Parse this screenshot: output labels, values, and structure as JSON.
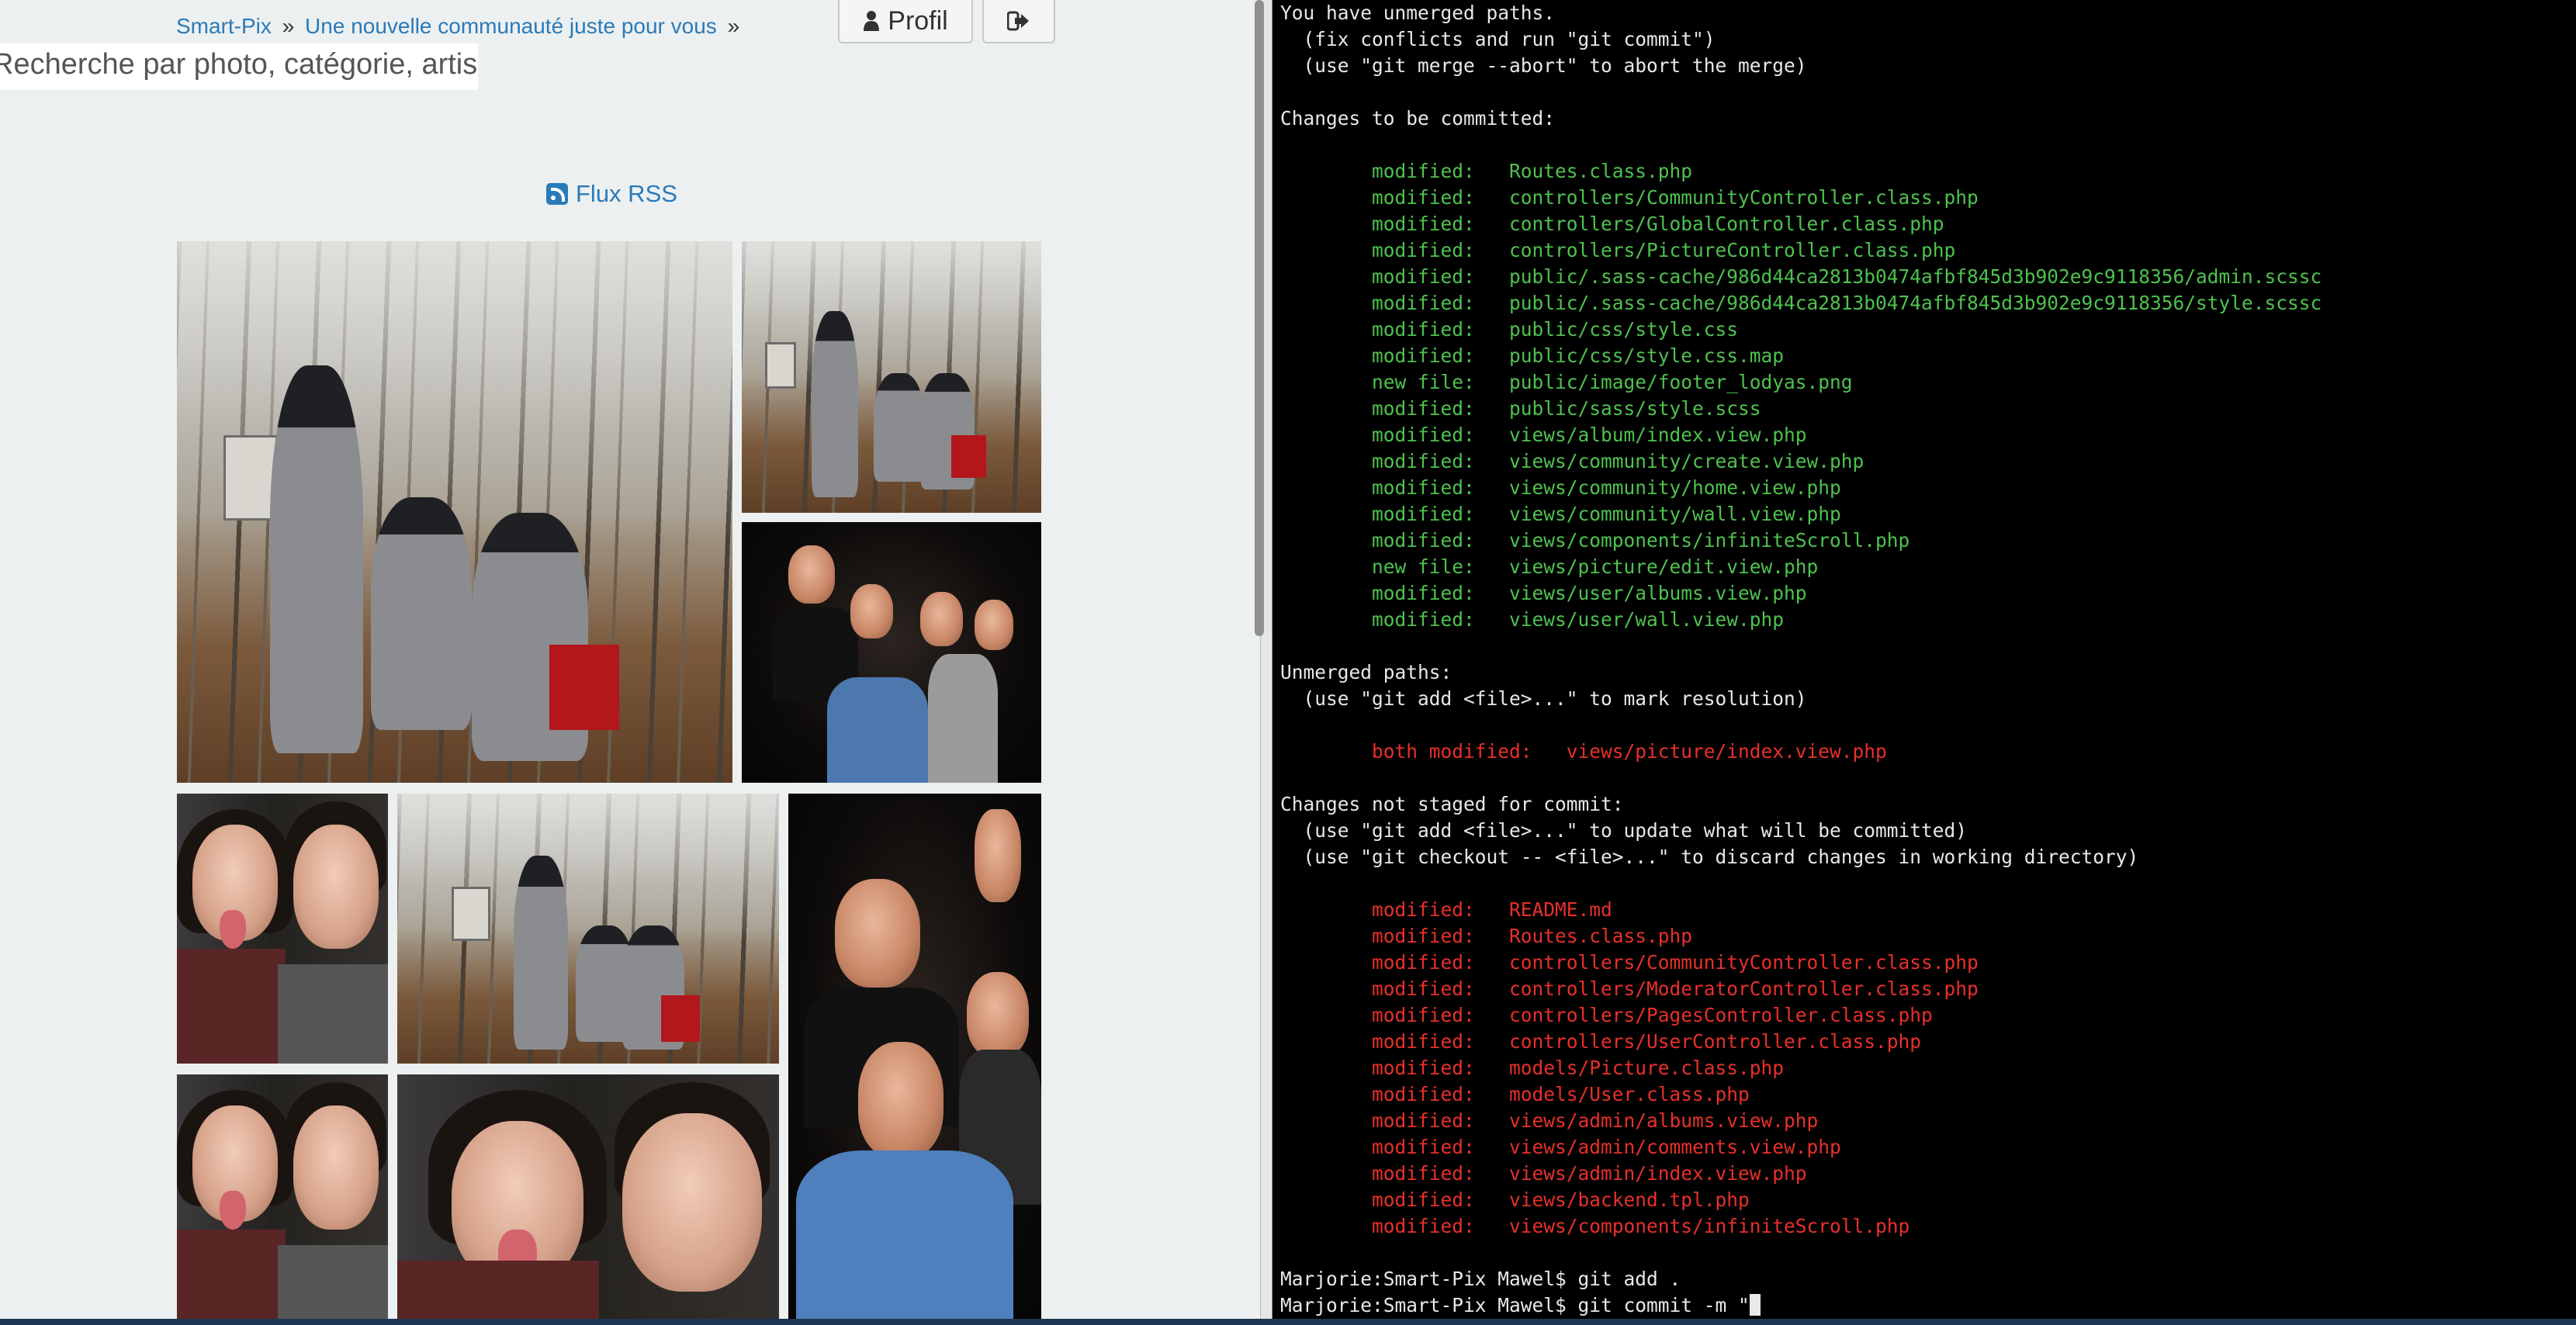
{
  "browser": {
    "breadcrumb": [
      {
        "label": "Smart-Pix",
        "sep": "»"
      },
      {
        "label": "Une nouvelle communauté juste pour vous",
        "sep": "»"
      }
    ],
    "buttons": {
      "profil_label": "Profil",
      "profil_icon": "user-icon",
      "logout_icon": "sign-out-icon"
    },
    "search": {
      "placeholder": "Recherche par photo, catégorie, artis"
    },
    "rss": {
      "label": "Flux RSS",
      "icon": "rss-icon"
    },
    "colors": {
      "link": "#2a7ab8",
      "background": "#ecf0f1"
    }
  },
  "terminal": {
    "lines": [
      {
        "text": "You have unmerged paths.",
        "style": "normal"
      },
      {
        "text": "  (fix conflicts and run \"git commit\")",
        "style": "normal"
      },
      {
        "text": "  (use \"git merge --abort\" to abort the merge)",
        "style": "normal"
      },
      {
        "text": "",
        "style": "normal"
      },
      {
        "text": "Changes to be committed:",
        "style": "normal"
      },
      {
        "text": "",
        "style": "normal"
      },
      {
        "text": "\tmodified:   Routes.class.php",
        "style": "green"
      },
      {
        "text": "\tmodified:   controllers/CommunityController.class.php",
        "style": "green"
      },
      {
        "text": "\tmodified:   controllers/GlobalController.class.php",
        "style": "green"
      },
      {
        "text": "\tmodified:   controllers/PictureController.class.php",
        "style": "green"
      },
      {
        "text": "\tmodified:   public/.sass-cache/986d44ca2813b0474afbf845d3b902e9c9118356/admin.scssc",
        "style": "green"
      },
      {
        "text": "\tmodified:   public/.sass-cache/986d44ca2813b0474afbf845d3b902e9c9118356/style.scssc",
        "style": "green"
      },
      {
        "text": "\tmodified:   public/css/style.css",
        "style": "green"
      },
      {
        "text": "\tmodified:   public/css/style.css.map",
        "style": "green"
      },
      {
        "text": "\tnew file:   public/image/footer_lodyas.png",
        "style": "green"
      },
      {
        "text": "\tmodified:   public/sass/style.scss",
        "style": "green"
      },
      {
        "text": "\tmodified:   views/album/index.view.php",
        "style": "green"
      },
      {
        "text": "\tmodified:   views/community/create.view.php",
        "style": "green"
      },
      {
        "text": "\tmodified:   views/community/home.view.php",
        "style": "green"
      },
      {
        "text": "\tmodified:   views/community/wall.view.php",
        "style": "green"
      },
      {
        "text": "\tmodified:   views/components/infiniteScroll.php",
        "style": "green"
      },
      {
        "text": "\tnew file:   views/picture/edit.view.php",
        "style": "green"
      },
      {
        "text": "\tmodified:   views/user/albums.view.php",
        "style": "green"
      },
      {
        "text": "\tmodified:   views/user/wall.view.php",
        "style": "green"
      },
      {
        "text": "",
        "style": "normal"
      },
      {
        "text": "Unmerged paths:",
        "style": "normal"
      },
      {
        "text": "  (use \"git add <file>...\" to mark resolution)",
        "style": "normal"
      },
      {
        "text": "",
        "style": "normal"
      },
      {
        "text": "\tboth modified:   views/picture/index.view.php",
        "style": "red"
      },
      {
        "text": "",
        "style": "normal"
      },
      {
        "text": "Changes not staged for commit:",
        "style": "normal"
      },
      {
        "text": "  (use \"git add <file>...\" to update what will be committed)",
        "style": "normal"
      },
      {
        "text": "  (use \"git checkout -- <file>...\" to discard changes in working directory)",
        "style": "normal"
      },
      {
        "text": "",
        "style": "normal"
      },
      {
        "text": "\tmodified:   README.md",
        "style": "red"
      },
      {
        "text": "\tmodified:   Routes.class.php",
        "style": "red"
      },
      {
        "text": "\tmodified:   controllers/CommunityController.class.php",
        "style": "red"
      },
      {
        "text": "\tmodified:   controllers/ModeratorController.class.php",
        "style": "red"
      },
      {
        "text": "\tmodified:   controllers/PagesController.class.php",
        "style": "red"
      },
      {
        "text": "\tmodified:   controllers/UserController.class.php",
        "style": "red"
      },
      {
        "text": "\tmodified:   models/Picture.class.php",
        "style": "red"
      },
      {
        "text": "\tmodified:   models/User.class.php",
        "style": "red"
      },
      {
        "text": "\tmodified:   views/admin/albums.view.php",
        "style": "red"
      },
      {
        "text": "\tmodified:   views/admin/comments.view.php",
        "style": "red"
      },
      {
        "text": "\tmodified:   views/admin/index.view.php",
        "style": "red"
      },
      {
        "text": "\tmodified:   views/backend.tpl.php",
        "style": "red"
      },
      {
        "text": "\tmodified:   views/components/infiniteScroll.php",
        "style": "red"
      },
      {
        "text": "",
        "style": "normal"
      },
      {
        "text": "Marjorie:Smart-Pix Mawel$ git add .",
        "style": "normal"
      },
      {
        "text": "Marjorie:Smart-Pix Mawel$ git commit -m \"",
        "style": "prompt"
      }
    ],
    "colors": {
      "staged": "#4ec24e",
      "unstaged": "#e8302a",
      "text": "#e8e8e8"
    }
  }
}
